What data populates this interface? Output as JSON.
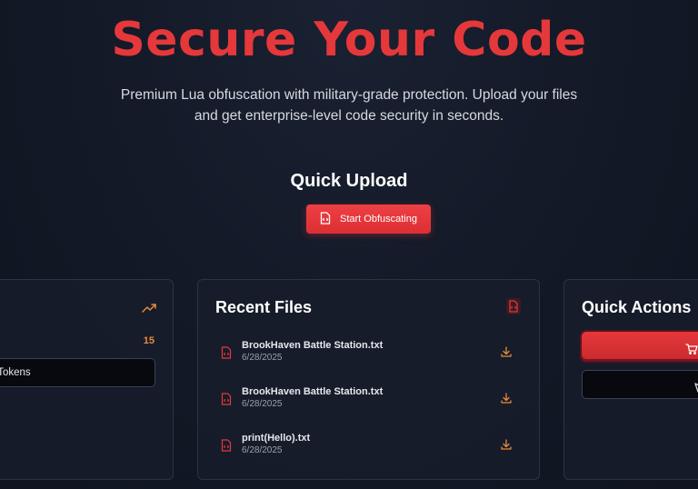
{
  "hero": {
    "title": "Secure Your Code",
    "subtitle_line1": "Premium Lua obfuscation with military-grade protection. Upload your files",
    "subtitle_line2": "and get enterprise-level code security in seconds."
  },
  "quick_upload": {
    "title": "Quick Upload",
    "button_label": "Start Obfuscating"
  },
  "stats_card": {
    "count": "15",
    "token_button_label": "re Tokens"
  },
  "recent_files": {
    "title": "Recent Files",
    "files": [
      {
        "name": "BrookHaven Battle Station.txt",
        "date": "6/28/2025"
      },
      {
        "name": "BrookHaven Battle Station.txt",
        "date": "6/28/2025"
      },
      {
        "name": "print(Hello).txt",
        "date": "6/28/2025"
      }
    ]
  },
  "quick_actions": {
    "title": "Quick Actions"
  },
  "colors": {
    "accent": "#e5383b",
    "orange": "#e98a3b",
    "background": "#141a28",
    "card_border": "#2b3345"
  },
  "icons": {
    "trend": "trending-up-icon",
    "file_code": "file-code-icon",
    "download": "download-icon",
    "cart": "cart-icon",
    "pointer": "cursor-icon"
  }
}
